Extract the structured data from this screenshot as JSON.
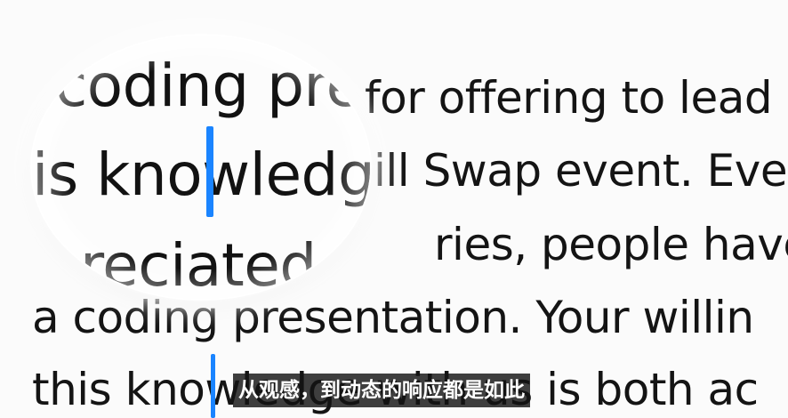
{
  "document": {
    "lines": [
      "for offering to lead",
      "ill Swap event. Eve",
      "ries, people have b",
      "a coding presentation. Your willin",
      "this knowledge with us is both ac"
    ]
  },
  "magnifier": {
    "lines": [
      "coding pre",
      "is knowledg",
      "reciated"
    ]
  },
  "subtitle": {
    "text": "从观感，到动态的响应都是如此"
  },
  "colors": {
    "caret": "#1a84ff",
    "text": "#141414",
    "background": "#fbfbfb",
    "subtitle_bg": "#141414"
  },
  "icons": {
    "caret": "text-cursor-icon"
  }
}
